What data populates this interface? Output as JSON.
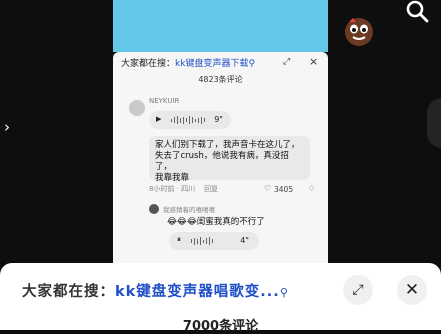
{
  "inner": {
    "search_prefix": "大家都在搜：",
    "search_keyword": "kk键盘变声器下载",
    "search_icon": "magnifier-icon",
    "expand_icon": "expand-icon",
    "close_icon": "close-icon",
    "comment_count": "4823条评论"
  },
  "comment": {
    "username": "NEYKUIR",
    "voice_duration": "9\"",
    "text_line1": "家人们别下载了，我声音卡在这儿了，",
    "text_line2": "失去了crush，他说我有病，真没招了，",
    "text_line3": "我靠我靠",
    "time_location": "8小时前 · 四川",
    "reply_label": "回复",
    "likes": "3405"
  },
  "reply": {
    "username": "我感猜着的嘻嘻嘻",
    "text": "😂😂😂闺蜜我真的不行了",
    "voice_duration": "4\""
  },
  "sheet": {
    "search_prefix": "大家都在搜：",
    "search_keyword": "kk键盘变声器唱歌变...",
    "search_icon": "magnifier-icon",
    "expand_icon": "expand-icon",
    "close_icon": "close-icon",
    "comment_count": "7000条评论"
  },
  "colors": {
    "video_bg": "#63c8e8",
    "keyword": "#1f4fc8",
    "sheet_bg": "#ffffff"
  }
}
